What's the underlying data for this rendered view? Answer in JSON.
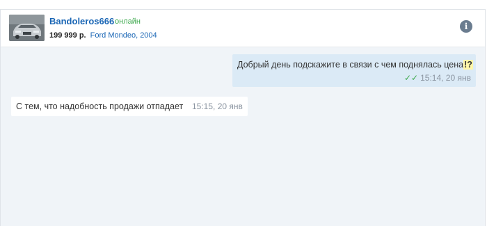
{
  "header": {
    "seller_name": "Bandoleros666",
    "status": "онлайн",
    "price": "199 999 р.",
    "car_model": "Ford Mondeo, 2004",
    "info_icon": "info-icon"
  },
  "messages": [
    {
      "direction": "outgoing",
      "text_main": "Добрый день подскажите в связи с чем поднялась цена",
      "text_highlight": "!?",
      "time": "15:14, 20 янв",
      "read_icon": "double-check-icon"
    },
    {
      "direction": "incoming",
      "text_main": "С тем, что надобность продажи отпадает",
      "time": "15:15, 20 янв"
    }
  ],
  "colors": {
    "accent": "#1a66b5",
    "online": "#3aa74a",
    "bubble_out": "#dbeaf6",
    "chat_bg": "#f0f4f8"
  }
}
